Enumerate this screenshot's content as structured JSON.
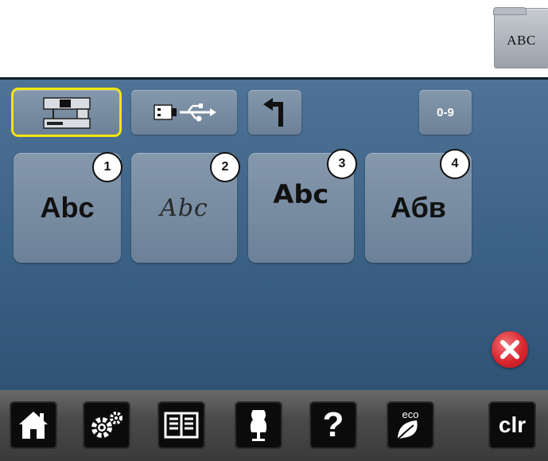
{
  "folder_tab": {
    "label": "ABC"
  },
  "toolbar": {
    "number_button_label": "0-9"
  },
  "fonts": [
    {
      "number": "1",
      "sample": "Abc"
    },
    {
      "number": "2",
      "sample": "Abc"
    },
    {
      "number": "3",
      "sample": "Abc"
    },
    {
      "number": "4",
      "sample": "Абв"
    }
  ],
  "bottom_nav": {
    "clr_label": "clr",
    "eco_label": "eco",
    "help_label": "?"
  },
  "colors": {
    "selection": "#f2e60f",
    "screen": "#3b6185",
    "close": "#d8262f"
  }
}
